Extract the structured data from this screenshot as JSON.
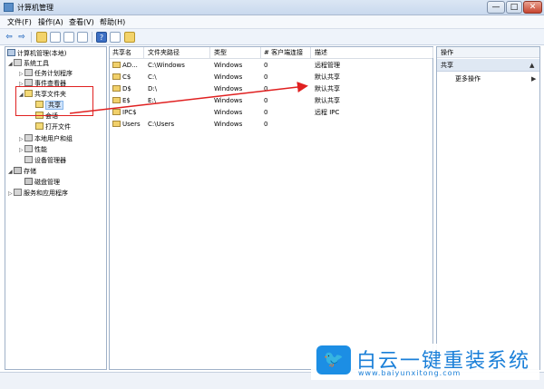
{
  "window": {
    "title": "计算机管理",
    "min_glyph": "—",
    "max_glyph": "□",
    "close_glyph": "✕"
  },
  "menu": [
    "文件(F)",
    "操作(A)",
    "查看(V)",
    "帮助(H)"
  ],
  "toolbar": {
    "back_glyph": "⇦",
    "forward_glyph": "⇨",
    "help_glyph": "?"
  },
  "tree": {
    "root": "计算机管理(本地)",
    "system_tools": "系统工具",
    "task_scheduler": "任务计划程序",
    "event_viewer": "事件查看器",
    "shared_folders": "共享文件夹",
    "shares": "共享",
    "sessions": "会话",
    "open_files": "打开文件",
    "local_users": "本地用户和组",
    "performance": "性能",
    "device_manager": "设备管理器",
    "storage": "存储",
    "disk_management": "磁盘管理",
    "services_apps": "服务和应用程序",
    "expanded_glyph": "◢",
    "collapsed_glyph": "▷"
  },
  "list": {
    "columns": [
      "共享名",
      "文件夹路径",
      "类型",
      "# 客户端连接",
      "描述"
    ],
    "rows": [
      {
        "name": "AD...",
        "path": "C:\\Windows",
        "type": "Windows",
        "clients": "0",
        "desc": "远程管理"
      },
      {
        "name": "C$",
        "path": "C:\\",
        "type": "Windows",
        "clients": "0",
        "desc": "默认共享"
      },
      {
        "name": "D$",
        "path": "D:\\",
        "type": "Windows",
        "clients": "0",
        "desc": "默认共享"
      },
      {
        "name": "E$",
        "path": "E:\\",
        "type": "Windows",
        "clients": "0",
        "desc": "默认共享"
      },
      {
        "name": "IPC$",
        "path": "",
        "type": "Windows",
        "clients": "0",
        "desc": "远程 IPC"
      },
      {
        "name": "Users",
        "path": "C:\\Users",
        "type": "Windows",
        "clients": "0",
        "desc": ""
      }
    ]
  },
  "actions": {
    "header": "操作",
    "section": "共享",
    "more": "更多操作",
    "section_arrow": "▲",
    "more_arrow": "▶"
  },
  "watermark": {
    "logo_glyph": "🐦",
    "name": "白云一键重装系统",
    "url": "www.baiyunxitong.com"
  },
  "colors": {
    "annotation": "#e02020",
    "brand": "#1a7fd8"
  }
}
